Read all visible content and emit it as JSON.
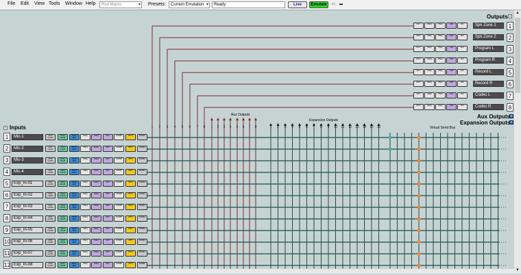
{
  "menu": [
    "File",
    "Edit",
    "View",
    "Tools",
    "Window",
    "Help"
  ],
  "toolbar": {
    "macro_value": "Run Macro",
    "presets_label": "Presets:",
    "presets_value": "Current Emulation",
    "status": "Ready",
    "live_label": "Live",
    "emulate_label": "Emulate"
  },
  "headers": {
    "inputs": "Inputs",
    "outputs": "Outputs",
    "aux_outputs": "Aux Outputs",
    "expansion_outputs": "Expansion Outputs",
    "aux_small": "Aux Outputs",
    "exp_small": "Expansion Outputs",
    "vsb": "Virtual Send Bus"
  },
  "inputs": [
    {
      "num": "1",
      "name": "Mic-1",
      "enabled": true
    },
    {
      "num": "2",
      "name": "Mic-2",
      "enabled": true
    },
    {
      "num": "3",
      "name": "Mic-3",
      "enabled": true
    },
    {
      "num": "4",
      "name": "Mic-4",
      "enabled": true
    },
    {
      "num": "5",
      "name": "Exp_In-01",
      "enabled": false
    },
    {
      "num": "6",
      "name": "Exp_In-02",
      "enabled": false
    },
    {
      "num": "7",
      "name": "Exp_In-03",
      "enabled": false
    },
    {
      "num": "8",
      "name": "Exp_In-04",
      "enabled": false
    },
    {
      "num": "9",
      "name": "Exp_In-05",
      "enabled": false
    },
    {
      "num": "10",
      "name": "Exp_In-06",
      "enabled": false
    },
    {
      "num": "11",
      "name": "Exp_In-07",
      "enabled": false
    },
    {
      "num": "12",
      "name": "Exp_In-08",
      "enabled": false
    }
  ],
  "outputs": [
    {
      "num": "1",
      "name": "Spk Zone 1"
    },
    {
      "num": "2",
      "name": "Spk Zone 2"
    },
    {
      "num": "3",
      "name": "Program L"
    },
    {
      "num": "4",
      "name": "Program R"
    },
    {
      "num": "5",
      "name": "Record L"
    },
    {
      "num": "6",
      "name": "Record R"
    },
    {
      "num": "7",
      "name": "Codec L"
    },
    {
      "num": "8",
      "name": "Codec R"
    }
  ],
  "input_chain": [
    "ANC GATE",
    "AGC FSUP",
    "NGC AEC",
    "PEQ",
    "GEQ",
    "DLY",
    "COMP",
    "MTX",
    "LEVEL"
  ],
  "output_chain": [
    "FILT",
    "GEQ",
    "PEQ",
    "LIM",
    "DLY"
  ],
  "matrix_cols": {
    "main": [
      "1",
      "2",
      "3",
      "4",
      "5",
      "6",
      "7",
      "8"
    ],
    "aux": [
      "1",
      "2",
      "3",
      "4",
      "5",
      "6",
      "7",
      "8"
    ],
    "expansion": [
      "1",
      "2",
      "3",
      "4",
      "5",
      "6",
      "7",
      "8",
      "9",
      "10",
      "11",
      "12",
      "13",
      "14",
      "15",
      "16"
    ]
  },
  "colors": {
    "background": "#c6d3d3",
    "route_line": "#7a2a2a",
    "grid_line": "#244848",
    "node_orange": "#f08a3c",
    "node_teal": "#47b6b0",
    "emulate_green": "#29d529"
  }
}
